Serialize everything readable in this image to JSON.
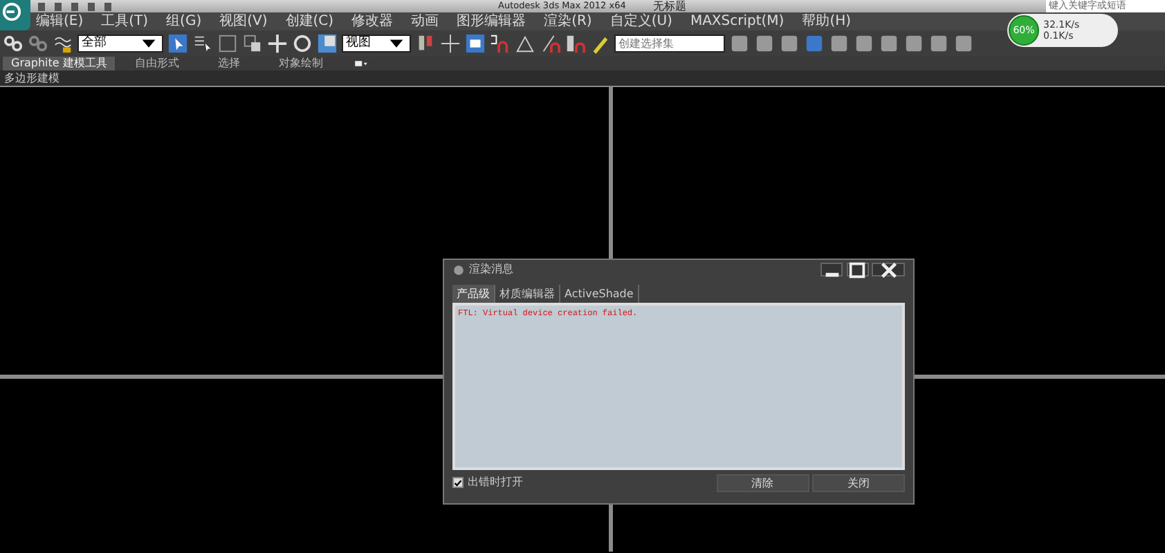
{
  "window": {
    "title": "Autodesk 3ds Max  2012 x64",
    "document": "无标题",
    "search": {
      "placeholder": "键入关键字或短语"
    }
  },
  "menu": [
    "编辑(E)",
    "工具(T)",
    "组(G)",
    "视图(V)",
    "创建(C)",
    "修改器",
    "动画",
    "图形编辑器",
    "渲染(R)",
    "自定义(U)",
    "MAXScript(M)",
    "帮助(H)"
  ],
  "toolbar": {
    "selection_filter": "全部",
    "reference_coord": "视图",
    "named_selection": {
      "placeholder": "创建选择集"
    }
  },
  "net_meter": {
    "percent": "60%",
    "upload": "32.1K/s",
    "download": "0.1K/s"
  },
  "ribbon": {
    "tabs": [
      {
        "label": "Graphite 建模工具",
        "selected": true
      },
      {
        "label": "自由形式",
        "selected": false
      },
      {
        "label": "选择",
        "selected": false
      },
      {
        "label": "对象绘制",
        "selected": false
      }
    ],
    "panel_label": "多边形建模"
  },
  "dialog": {
    "title": "渲染消息",
    "tabs": [
      {
        "label": "产品级",
        "selected": true
      },
      {
        "label": "材质编辑器",
        "selected": false
      },
      {
        "label": "ActiveShade",
        "selected": false
      }
    ],
    "messages": [
      "FTL: Virtual device creation failed."
    ],
    "open_on_error": {
      "label": "出错时打开",
      "checked": true
    },
    "buttons": [
      "清除",
      "关闭"
    ]
  }
}
